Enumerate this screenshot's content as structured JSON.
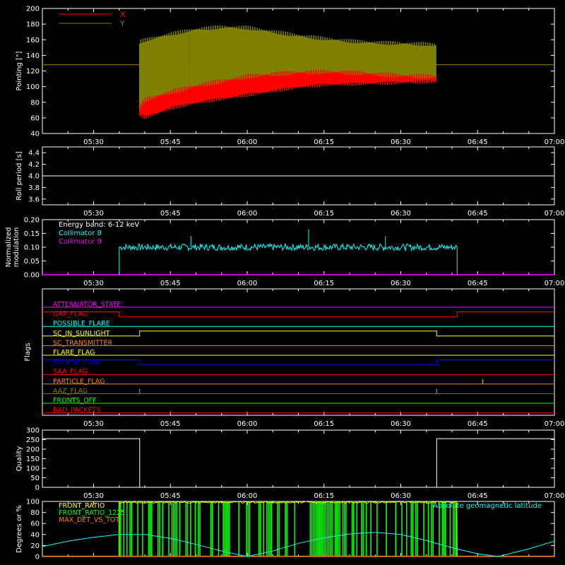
{
  "chart_data": [
    {
      "type": "line",
      "id": "pointing",
      "ylabel": "Pointing [\"]",
      "xlim": [
        "05:20",
        "07:00"
      ],
      "ylim": [
        40,
        200
      ],
      "yticks": [
        40,
        60,
        80,
        100,
        120,
        140,
        160,
        180,
        200
      ],
      "xticks": [
        "05:30",
        "05:45",
        "06:00",
        "06:15",
        "06:30",
        "06:45",
        "07:00"
      ],
      "legend_position": "top-left",
      "series": [
        {
          "name": "X",
          "color": "#ff0000",
          "envelope_time": [
            "05:39",
            "05:40",
            "05:45",
            "05:50",
            "05:55",
            "06:00",
            "06:05",
            "06:10",
            "06:15",
            "06:20",
            "06:25",
            "06:30",
            "06:35",
            "06:37"
          ],
          "envelope_min": [
            62,
            58,
            70,
            77,
            82,
            87,
            92,
            97,
            100,
            101,
            102,
            103,
            104,
            104
          ],
          "envelope_max": [
            125,
            112,
            118,
            122,
            128,
            130,
            133,
            137,
            140,
            142,
            143,
            145,
            146,
            148
          ],
          "baseline_value": 128
        },
        {
          "name": "Y",
          "color": "#808000",
          "envelope_time": [
            "05:39",
            "05:40",
            "05:45",
            "05:50",
            "05:55",
            "06:00",
            "06:05",
            "06:10",
            "06:15",
            "06:20",
            "06:25",
            "06:30",
            "06:35",
            "06:37"
          ],
          "envelope_min": [
            72,
            80,
            90,
            98,
            104,
            110,
            113,
            115,
            116,
            115,
            113,
            111,
            110,
            110
          ],
          "envelope_max": [
            160,
            162,
            170,
            176,
            179,
            178,
            173,
            168,
            164,
            161,
            159,
            158,
            157,
            156
          ],
          "baseline_value": 128
        }
      ]
    },
    {
      "type": "line",
      "id": "roll",
      "ylabel": "Roll period [s]",
      "xlim": [
        "05:20",
        "07:00"
      ],
      "ylim": [
        3.5,
        4.5
      ],
      "yticks": [
        3.6,
        3.8,
        4.0,
        4.2,
        4.4
      ],
      "ytick_labels": [
        "3.6",
        "3.8",
        "4.0",
        "4.2",
        "4.4"
      ],
      "xticks": [
        "05:30",
        "05:45",
        "06:00",
        "06:15",
        "06:30",
        "06:45",
        "07:00"
      ],
      "series": [
        {
          "color": "#ffffff",
          "x": [
            "05:20",
            "07:00"
          ],
          "y": [
            4.0,
            4.0
          ]
        }
      ]
    },
    {
      "type": "line",
      "id": "modulation",
      "ylabel": "Normalized modulation",
      "xlim": [
        "05:20",
        "07:00"
      ],
      "ylim": [
        0,
        0.2
      ],
      "yticks": [
        0,
        0.05,
        0.1,
        0.15,
        0.2
      ],
      "ytick_labels": [
        "0.00",
        "0.05",
        "0.10",
        "0.15",
        "0.20"
      ],
      "xticks": [
        "05:30",
        "05:45",
        "06:00",
        "06:15",
        "06:30",
        "06:45",
        "07:00"
      ],
      "annotation": "Energy band: 6-12 keV",
      "legend_position": "top-left",
      "series": [
        {
          "name": "Collimator 8",
          "color": "#00ffff",
          "active_range": [
            "05:35",
            "06:41"
          ],
          "mean": 0.1,
          "noise": 0.012,
          "spikes": [
            [
              "06:12",
              0.165
            ],
            [
              "05:49",
              0.14
            ],
            [
              "06:27",
              0.14
            ]
          ]
        },
        {
          "name": "Collimator 9",
          "color": "#ff00ff",
          "x": [
            "05:20",
            "07:00"
          ],
          "y": [
            0,
            0
          ]
        }
      ]
    },
    {
      "type": "line",
      "id": "flags",
      "ylabel": "Flags",
      "xlim": [
        "05:20",
        "07:00"
      ],
      "xticks": [
        "05:30",
        "05:45",
        "06:00",
        "06:15",
        "06:30",
        "06:45",
        "07:00"
      ],
      "flags": [
        {
          "name": "ATTENUATOR_STATE",
          "color": "#ff00ff",
          "segments": [
            [
              "05:20",
              "07:00",
              0
            ]
          ]
        },
        {
          "name": "GAP_FLAG",
          "color": "#ff0000",
          "segments": [
            [
              "05:20",
              "05:35",
              1
            ],
            [
              "05:35",
              "06:41",
              0
            ],
            [
              "06:41",
              "07:00",
              1
            ]
          ]
        },
        {
          "name": "POSSIBLE_FLARE",
          "color": "#00ffff",
          "segments": [
            [
              "05:20",
              "07:00",
              0
            ]
          ]
        },
        {
          "name": "SC_IN_SUNLIGHT",
          "color": "#ffff00",
          "segments": [
            [
              "05:20",
              "05:39",
              0
            ],
            [
              "05:39",
              "06:37",
              1
            ],
            [
              "06:37",
              "07:00",
              0
            ]
          ]
        },
        {
          "name": "SC_TRANSMITTER",
          "color": "#ff8000",
          "segments": [
            [
              "05:20",
              "07:00",
              0
            ]
          ]
        },
        {
          "name": "FLARE_FLAG",
          "color": "#ffff00",
          "segments": [
            [
              "05:20",
              "07:00",
              0
            ]
          ]
        },
        {
          "name": "ECLIPSE_FLAG",
          "color": "#0000ff",
          "segments": [
            [
              "05:20",
              "05:39",
              1
            ],
            [
              "05:39",
              "06:37",
              0
            ],
            [
              "06:37",
              "07:00",
              1
            ]
          ]
        },
        {
          "name": "SAA_FLAG",
          "color": "#ff0000",
          "segments": [
            [
              "05:20",
              "07:00",
              0
            ]
          ]
        },
        {
          "name": "PARTICLE_FLAG",
          "color": "#ff8000",
          "segments": [
            [
              "05:20",
              "07:00",
              0
            ]
          ],
          "spikes": [
            "06:46"
          ]
        },
        {
          "name": "AAZ_FLAG",
          "color": "#808000",
          "segments": [
            [
              "05:20",
              "07:00",
              0
            ]
          ],
          "spikes": [
            "05:39",
            "06:37"
          ]
        },
        {
          "name": "FRONTS_OFF",
          "color": "#00ff00",
          "segments": [
            [
              "05:20",
              "07:00",
              0
            ]
          ]
        },
        {
          "name": "BAD_PACKETS",
          "color": "#ff0000",
          "segments": [
            [
              "05:20",
              "07:00",
              0
            ]
          ]
        }
      ]
    },
    {
      "type": "line",
      "id": "quality",
      "ylabel": "Quality",
      "xlim": [
        "05:20",
        "07:00"
      ],
      "ylim": [
        0,
        300
      ],
      "yticks": [
        0,
        50,
        100,
        150,
        200,
        250,
        300
      ],
      "xticks": [
        "05:30",
        "05:45",
        "06:00",
        "06:15",
        "06:30",
        "06:45",
        "07:00"
      ],
      "series": [
        {
          "color": "#ffffff",
          "x": [
            "05:20",
            "05:39",
            "05:39",
            "06:37",
            "06:37",
            "07:00"
          ],
          "y": [
            255,
            255,
            0,
            0,
            255,
            255
          ]
        }
      ]
    },
    {
      "type": "line",
      "id": "ratios",
      "ylabel": "Degrees or %",
      "xlim": [
        "05:20",
        "07:00"
      ],
      "ylim": [
        0,
        100
      ],
      "yticks": [
        0,
        20,
        40,
        60,
        80,
        100
      ],
      "legend_position": "top-left",
      "series": [
        {
          "name": "FRONT_RATIO",
          "color": "#ffff00",
          "active_range": [
            "05:35",
            "06:41"
          ]
        },
        {
          "name": "FRONT_RATIO_1225",
          "color": "#00ff00",
          "active_range": [
            "05:35",
            "06:41"
          ]
        },
        {
          "name": "MAX_DET_VS_TOT",
          "color": "#ff8000",
          "active_range": [
            "05:35",
            "06:41"
          ]
        },
        {
          "name": "Absolute geomagnetic latitude",
          "color": "#00ffff",
          "x": [
            "05:20",
            "05:25",
            "05:30",
            "05:35",
            "05:40",
            "05:45",
            "05:50",
            "05:55",
            "06:00",
            "06:05",
            "06:10",
            "06:15",
            "06:20",
            "06:25",
            "06:30",
            "06:35",
            "06:40",
            "06:45",
            "06:49",
            "06:55",
            "07:00"
          ],
          "y": [
            18,
            28,
            35,
            40,
            40,
            33,
            22,
            10,
            0,
            10,
            24,
            34,
            41,
            44,
            40,
            29,
            16,
            5,
            0,
            14,
            28
          ]
        }
      ]
    }
  ]
}
